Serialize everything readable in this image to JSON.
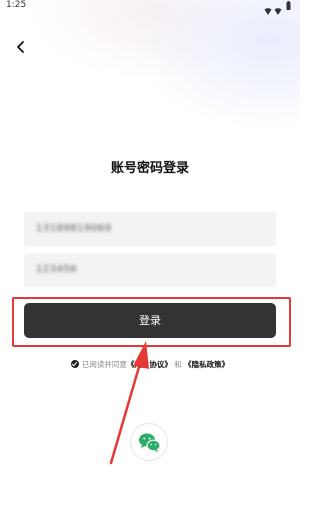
{
  "status_bar": {
    "time": "1:25",
    "icons": [
      "wifi-icon",
      "battery-icon"
    ]
  },
  "header": {
    "back_icon": "chevron-left-icon"
  },
  "login": {
    "title": "账号密码登录",
    "account_value": "13189819069",
    "password_value": "123456",
    "submit_label": "登录"
  },
  "agreement": {
    "prefix": "已阅读并同意",
    "user_agreement": "《用户协议》",
    "conjunction": "和",
    "privacy_policy": "《隐私政策》"
  },
  "social_login": {
    "wechat_icon": "wechat-icon"
  },
  "annotation": {
    "highlight_color": "#e53935"
  },
  "colors": {
    "button_bg": "#333333",
    "input_bg": "#f3f3f4",
    "wechat_green": "#2aae67"
  }
}
